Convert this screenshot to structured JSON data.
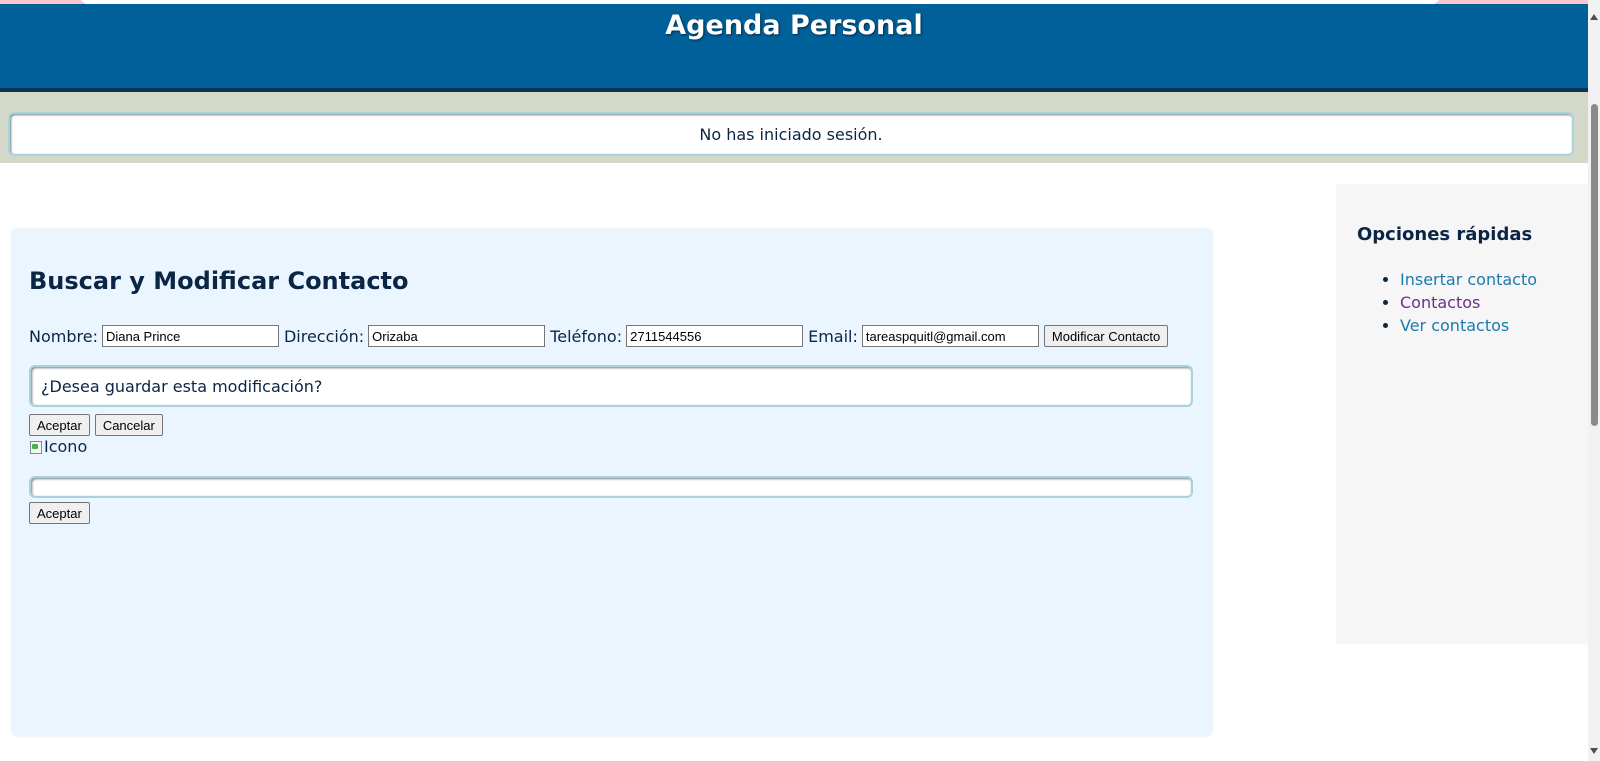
{
  "header": {
    "title": "Agenda Personal"
  },
  "session": {
    "status_text": "No has iniciado sesión."
  },
  "main": {
    "heading": "Buscar y Modificar Contacto",
    "fields": {
      "nombre_label": "Nombre:",
      "nombre_value": "Diana Prince",
      "direccion_label": "Dirección:",
      "direccion_value": "Orizaba",
      "telefono_label": "Teléfono:",
      "telefono_value": "2711544556",
      "email_label": "Email:",
      "email_value": "tareaspquitl@gmail.com"
    },
    "modify_button": "Modificar Contacto",
    "confirm": {
      "question": "¿Desea guardar esta modificación?",
      "accept": "Aceptar",
      "cancel": "Cancelar"
    },
    "icon_alt": "Icono",
    "result": {
      "message": "",
      "accept": "Aceptar"
    }
  },
  "sidebar": {
    "title": "Opciones rápidas",
    "links": [
      {
        "label": "Insertar contacto"
      },
      {
        "label": "Contactos"
      },
      {
        "label": "Ver contactos"
      }
    ]
  },
  "colors": {
    "header_bg": "#00609a",
    "band_bg": "#d4d8c8",
    "main_bg": "#eaf5ff",
    "link": "#1a7ab0",
    "visited_link": "#6b2f8a"
  },
  "icons": {
    "broken_image": "broken-image-icon"
  }
}
